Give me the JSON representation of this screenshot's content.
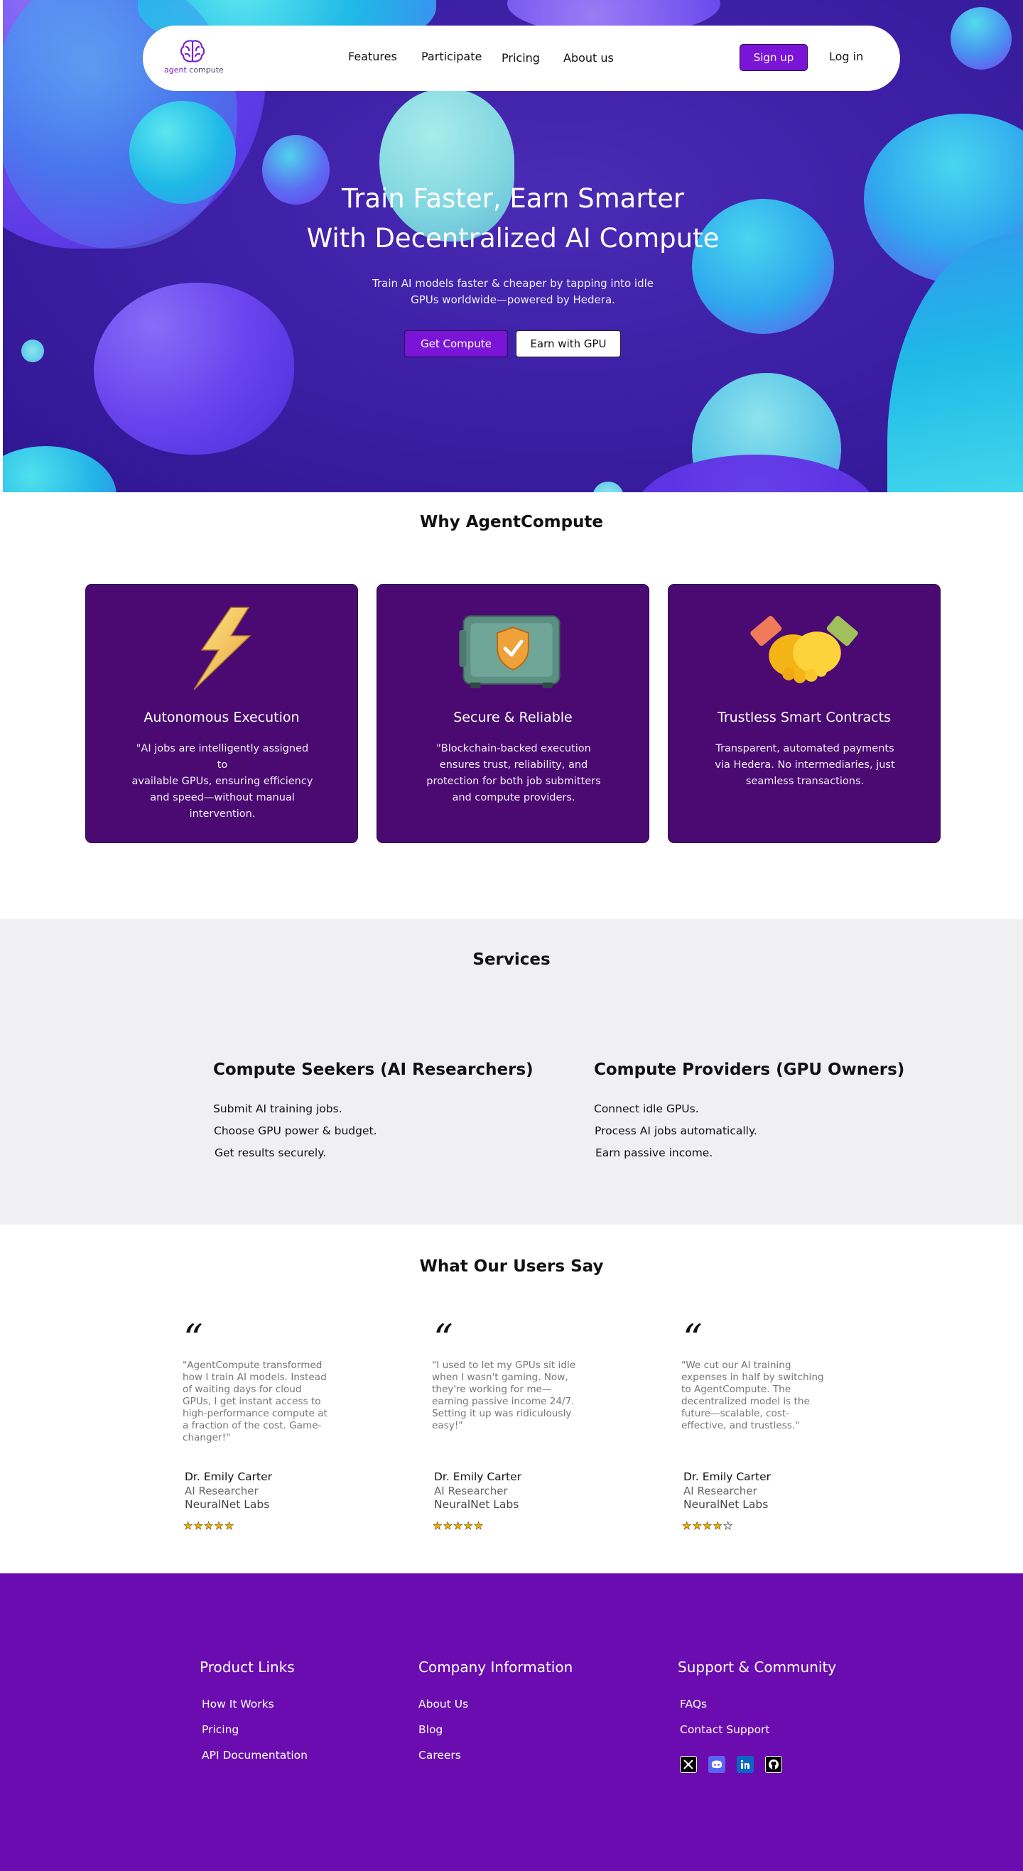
{
  "brand": {
    "name_part1": "agent",
    "name_part2": " compute"
  },
  "nav": {
    "links": [
      "Features",
      "Participate",
      "Pricing",
      "About us"
    ],
    "signup": "Sign up",
    "login": "Log in"
  },
  "hero": {
    "title_line1": "Train Faster, Earn Smarter",
    "title_line2": "With Decentralized AI Compute",
    "subtitle_line1": "Train AI models faster & cheaper by tapping into idle",
    "subtitle_line2": "GPUs worldwide—powered by Hedera.",
    "cta_primary": "Get Compute",
    "cta_secondary": "Earn with GPU"
  },
  "why": {
    "title": "Why AgentCompute",
    "cards": [
      {
        "icon": "lightning-icon",
        "title": "Autonomous Execution",
        "lines": [
          "\"AI jobs are intelligently assigned to",
          "available GPUs, ensuring efficiency",
          "and speed—without manual",
          "intervention."
        ]
      },
      {
        "icon": "safe-shield-icon",
        "title": "Secure & Reliable",
        "lines": [
          "\"Blockchain-backed execution",
          "ensures trust, reliability, and",
          "protection for both job submitters",
          "and compute providers."
        ]
      },
      {
        "icon": "handshake-icon",
        "title": "Trustless Smart Contracts",
        "lines": [
          "Transparent, automated payments",
          "via Hedera. No intermediaries, just",
          "seamless transactions."
        ]
      }
    ]
  },
  "services": {
    "title": "Services",
    "seekers": {
      "heading": "Compute Seekers (AI Researchers)",
      "items": [
        "Submit AI training jobs.",
        "Choose GPU power & budget.",
        "Get results securely."
      ]
    },
    "providers": {
      "heading": "Compute Providers (GPU Owners)",
      "items": [
        "Connect idle GPUs.",
        "Process AI jobs automatically.",
        "Earn passive income."
      ]
    }
  },
  "testimonials": {
    "title": "What Our Users Say",
    "quote_mark": "“",
    "items": [
      {
        "lines": [
          " \"AgentCompute transformed",
          "how I train AI models. Instead",
          "of waiting days for cloud",
          "GPUs, I get instant access to",
          "high-performance compute at",
          "a fraction of the cost. Game-",
          "changer!\""
        ],
        "name": "Dr. Emily Carter",
        "role": "AI Researcher",
        "org": "NeuralNet Labs",
        "rating": 5
      },
      {
        "lines": [
          "\"I used to let my GPUs sit idle",
          "when I wasn't gaming. Now,",
          "they're working for me—",
          "earning passive income 24/7.",
          "Setting it up was ridiculously",
          "easy!\""
        ],
        "name": "Dr. Emily Carter",
        "role": "AI Researcher",
        "org": "NeuralNet Labs",
        "rating": 5
      },
      {
        "lines": [
          "\"We cut our AI training",
          "expenses in half by switching",
          "to AgentCompute. The",
          "decentralized model is the",
          "future—scalable, cost-",
          "effective, and trustless.\""
        ],
        "name": "Dr. Emily Carter",
        "role": "AI Researcher",
        "org": "NeuralNet Labs",
        "rating": 4
      }
    ]
  },
  "footer": {
    "product": {
      "heading": "Product Links",
      "links": [
        "How It Works",
        "Pricing",
        "API Documentation"
      ]
    },
    "company": {
      "heading": "Company Information",
      "links": [
        "About Us",
        "Blog",
        "Careers"
      ]
    },
    "support": {
      "heading": "Support & Community",
      "links": [
        "FAQs",
        "Contact Support"
      ],
      "social": [
        "x-icon",
        "discord-icon",
        "linkedin-icon",
        "github-icon"
      ]
    }
  },
  "colors": {
    "accent": "#7a14d6",
    "card": "#4a0a72",
    "footer": "#6a0caf",
    "services_bg": "#f0f0f2"
  }
}
